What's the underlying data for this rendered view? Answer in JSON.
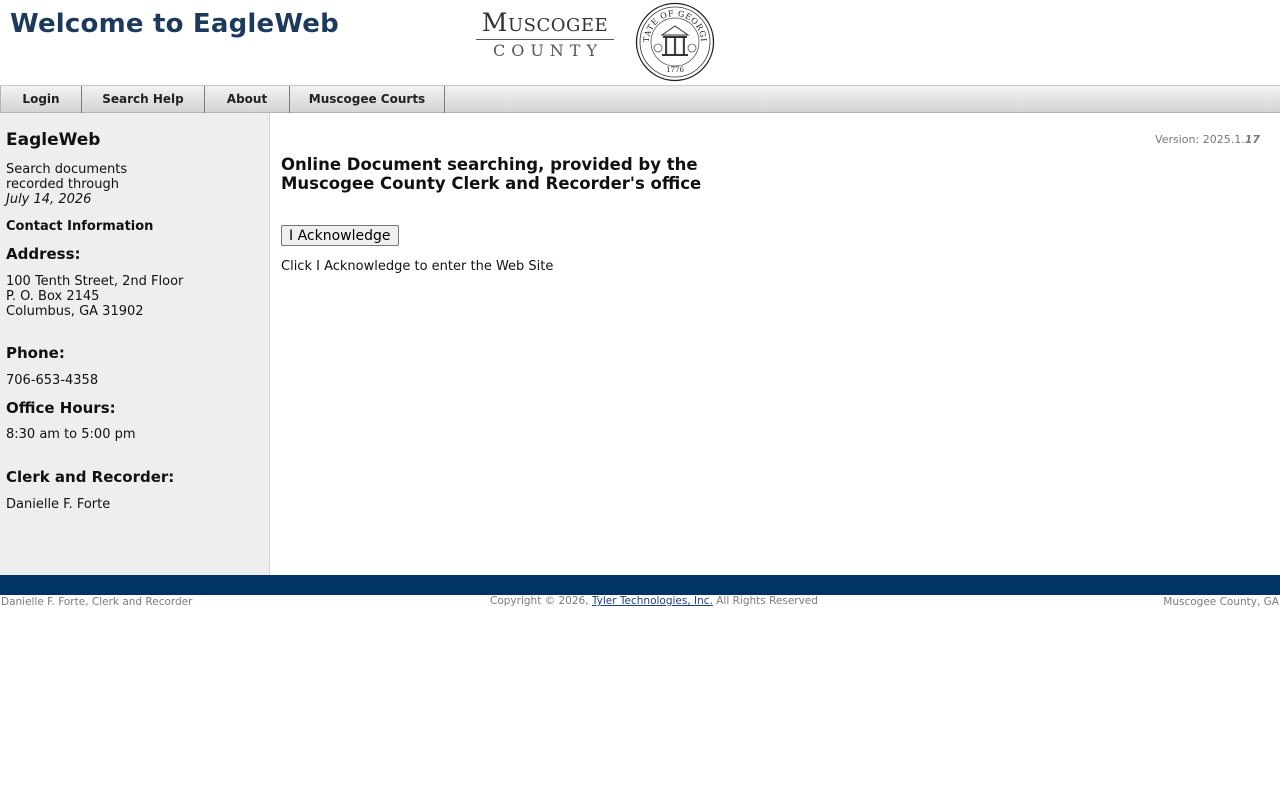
{
  "header": {
    "title": "Welcome to EagleWeb",
    "logo": {
      "line1": "Muscogee",
      "line2": "COUNTY",
      "seal_text": "STATE OF GEORGIA",
      "seal_year": "1776"
    }
  },
  "nav": {
    "items": [
      {
        "label": "Login"
      },
      {
        "label": "Search Help"
      },
      {
        "label": "About"
      },
      {
        "label": "Muscogee Courts"
      }
    ]
  },
  "sidebar": {
    "title": "EagleWeb",
    "search_line1": "Search documents",
    "search_line2": "recorded through",
    "recorded_date": "July 14, 2026",
    "contact_heading": "Contact Information",
    "address_heading": "Address:",
    "address_line1": "100 Tenth Street, 2nd Floor",
    "address_line2": "P. O. Box 2145",
    "address_line3": "Columbus, GA 31902",
    "phone_heading": "Phone:",
    "phone": "706-653-4358",
    "hours_heading": "Office Hours:",
    "hours": "8:30 am to 5:00 pm",
    "clerk_heading": "Clerk and Recorder:",
    "clerk_name": "Danielle F. Forte"
  },
  "main": {
    "version_prefix": "Version: 2025.1.",
    "version_build": "17",
    "intro_line1": "Online Document searching, provided by the",
    "intro_line2": "Muscogee County Clerk and Recorder's office",
    "ack_button": "I Acknowledge",
    "ack_note": "Click I Acknowledge to enter the Web Site"
  },
  "footer": {
    "left": "Danielle F. Forte, Clerk and Recorder",
    "copyright_prefix": "Copyright © 2026,",
    "company_link": "Tyler Technologies, Inc.",
    "copyright_suffix": "All Rights Reserved",
    "right": "Muscogee County, GA"
  },
  "colors": {
    "title": "#1b3a5c",
    "footer_bar": "#003366",
    "sidebar_bg": "#eeeeee",
    "link": "#1a3d8f"
  }
}
